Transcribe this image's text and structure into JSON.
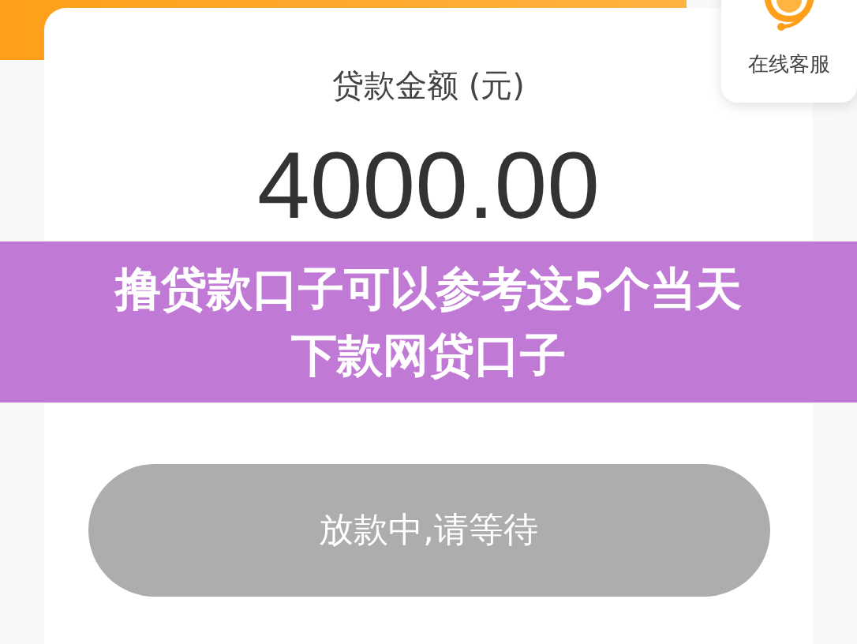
{
  "customer_service": {
    "label": "在线客服"
  },
  "loan": {
    "label": "贷款金额 (元)",
    "amount": "4000.00"
  },
  "banner": {
    "text": "撸贷款口子可以参考这5个当天下款网贷口子"
  },
  "action_button": {
    "label": "放款中,请等待",
    "disabled": true
  }
}
